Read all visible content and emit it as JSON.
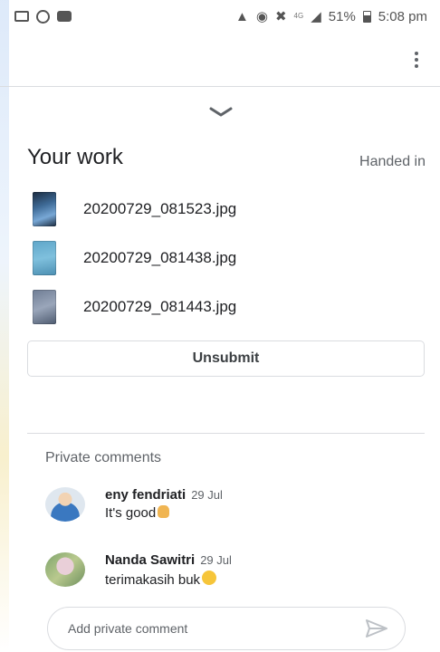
{
  "status_bar": {
    "left_icons": [
      "image-icon",
      "whatsapp-icon",
      "youtube-icon"
    ],
    "right_icons": [
      "android-icon",
      "location-icon",
      "mute-icon",
      "network-4g-icon",
      "signal-icon"
    ],
    "network": "4G",
    "battery": "51%",
    "battery_level": 0.51,
    "time": "5:08 pm"
  },
  "app_bar": {
    "menu_icon": "more-vert-icon"
  },
  "work": {
    "collapse_icon": "chevron-down-icon",
    "title": "Your work",
    "status": "Handed in",
    "attachments": [
      {
        "name": "20200729_081523.jpg"
      },
      {
        "name": "20200729_081438.jpg"
      },
      {
        "name": "20200729_081443.jpg"
      }
    ],
    "unsubmit_label": "Unsubmit"
  },
  "private_comments": {
    "title": "Private comments",
    "comments": [
      {
        "author": "eny fendriati",
        "date": "29 Jul",
        "text": "It's good",
        "emoji": "thumbs-up-icon"
      },
      {
        "author": "Nanda Sawitri",
        "date": "29 Jul",
        "text": "terimakasih buk",
        "emoji": "smile-icon"
      }
    ],
    "input_placeholder": "Add private comment",
    "send_icon": "send-icon"
  },
  "colors": {
    "text_primary": "#202124",
    "text_secondary": "#5f6368",
    "divider": "#dadce0",
    "icon": "#5f6368"
  }
}
